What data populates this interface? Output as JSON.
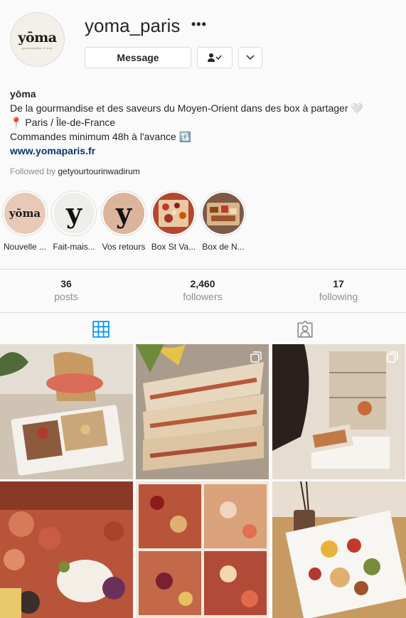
{
  "profile": {
    "avatar_logo": "yōma",
    "avatar_sub": "gourmandise & box",
    "username": "yoma_paris",
    "more": "•••",
    "message_label": "Message",
    "follow_icon": "person-check-icon",
    "suggest_icon": "chevron-down-icon"
  },
  "bio": {
    "name": "yōma",
    "line1": "De la gourmandise et des saveurs du Moyen-Orient dans des box à partager 🤍",
    "line2": "📍 Paris / Île-de-France",
    "line3": "Commandes minimum 48h à l'avance 🔃",
    "link": "www.yomaparis.fr",
    "followed_prefix": "Followed by",
    "followed_user": "getyourtourinwadirum"
  },
  "highlights": [
    {
      "label": "Nouvelle ...",
      "glyph": "yōma",
      "bg": "#e8c9b6"
    },
    {
      "label": "Fait-mais...",
      "glyph": "y",
      "bg": "#efeeea"
    },
    {
      "label": "Vos retours",
      "glyph": "y",
      "bg": "#dcb39b"
    },
    {
      "label": "Box St Va...",
      "glyph": "",
      "bg": "#b3472f"
    },
    {
      "label": "Box de N...",
      "glyph": "",
      "bg": "#7d5a45"
    }
  ],
  "stats": {
    "posts_num": "36",
    "posts_label": "posts",
    "followers_num": "2,460",
    "followers_label": "followers",
    "following_num": "17",
    "following_label": "following"
  },
  "tabs": {
    "posts_icon": "grid-icon",
    "tagged_icon": "tagged-person-icon",
    "active_color": "#0095f6"
  },
  "posts": [
    {
      "name": "post-box-chair",
      "multi": false
    },
    {
      "name": "post-quesadillas",
      "multi": true
    },
    {
      "name": "post-woman-box",
      "multi": true
    },
    {
      "name": "post-charcuterie-burrata",
      "multi": false
    },
    {
      "name": "post-four-boxes",
      "multi": false
    },
    {
      "name": "post-box-fruits",
      "multi": false
    }
  ]
}
